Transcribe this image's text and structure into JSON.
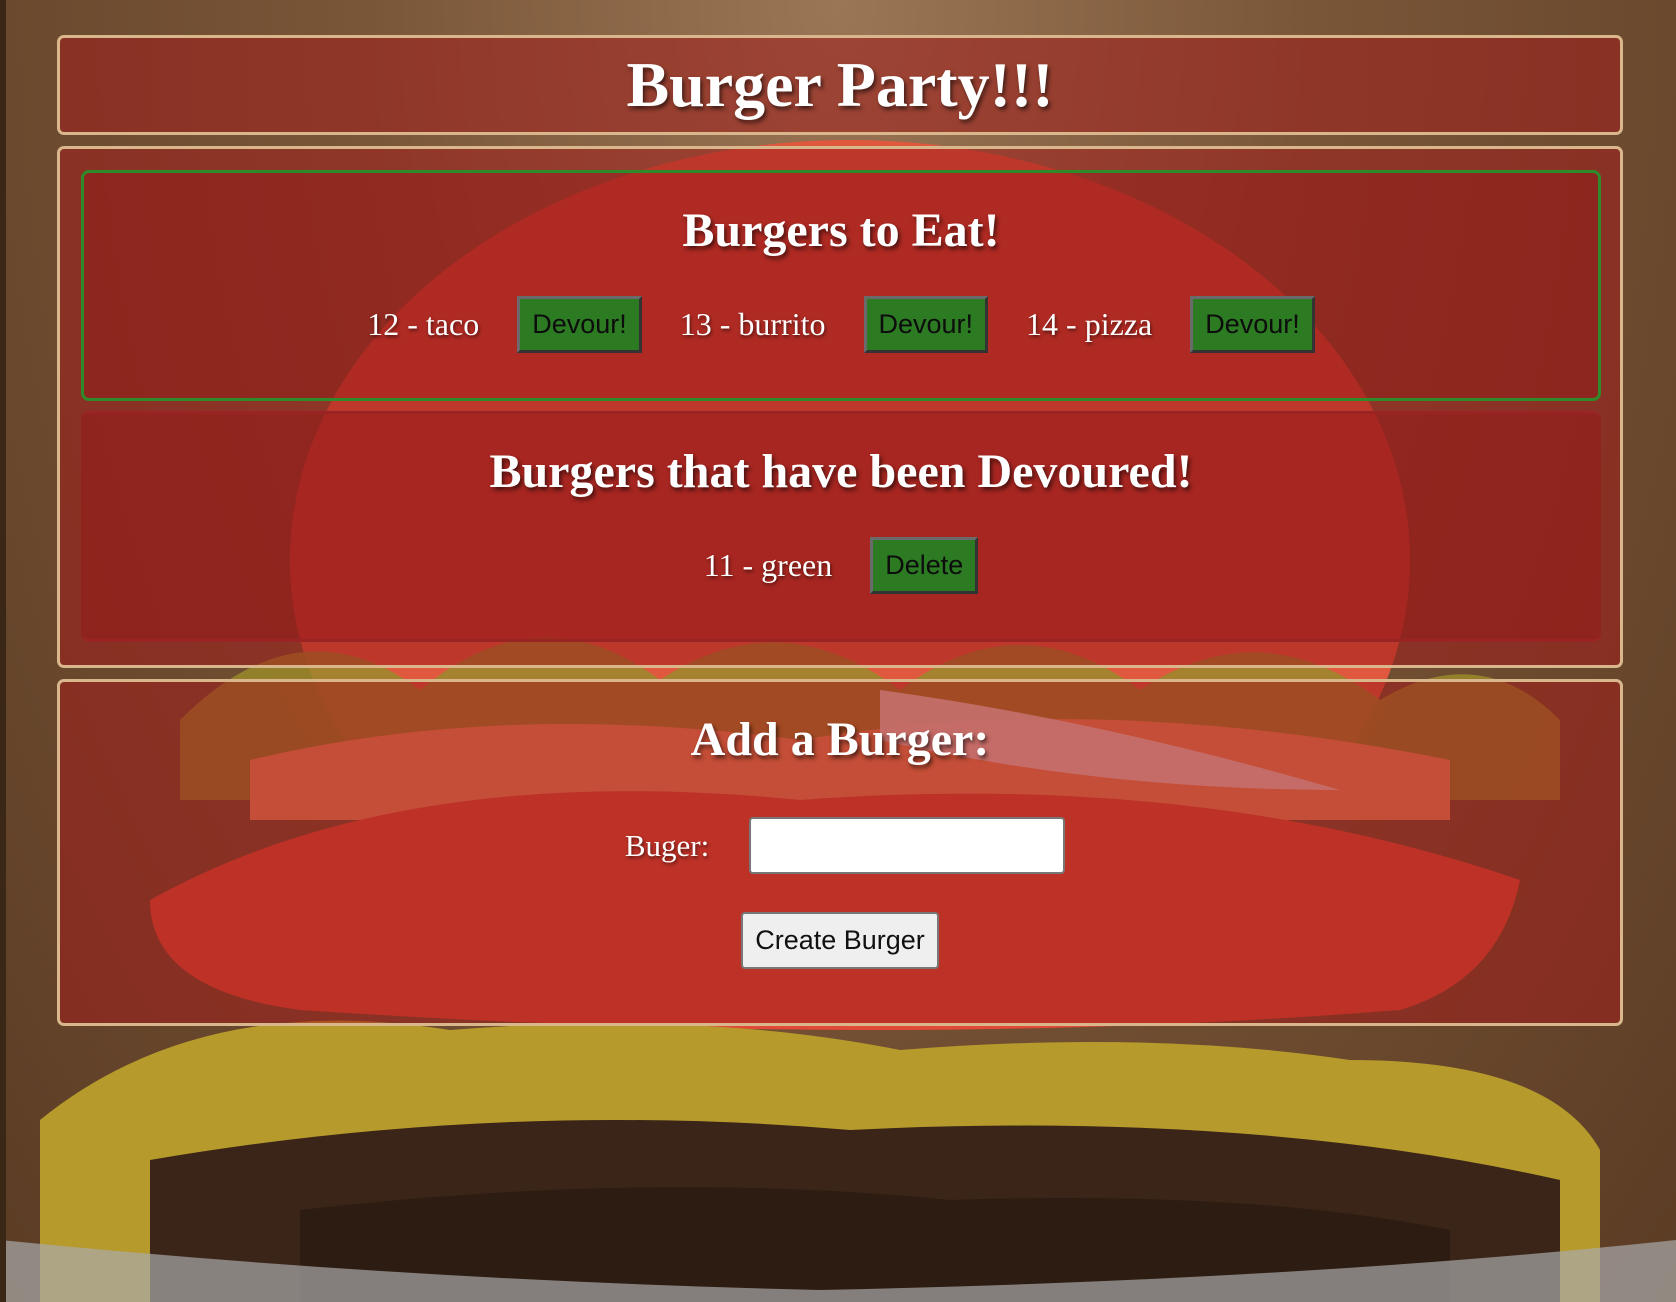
{
  "header": {
    "title": "Burger Party!!!"
  },
  "to_eat": {
    "heading": "Burgers to Eat!",
    "items": [
      {
        "label": "12 - taco",
        "button": "Devour!"
      },
      {
        "label": "13 - burrito",
        "button": "Devour!"
      },
      {
        "label": "14 - pizza",
        "button": "Devour!"
      }
    ]
  },
  "devoured": {
    "heading": "Burgers that have been Devoured!",
    "items": [
      {
        "label": "11 - green",
        "button": "Delete"
      }
    ]
  },
  "add": {
    "heading": "Add a Burger:",
    "input_label": "Buger:",
    "input_value": "",
    "submit_label": "Create Burger"
  },
  "colors": {
    "panel_border": "#d9b68c",
    "panel_bg": "#a01e1c",
    "to_eat_border": "#2f8a2a",
    "button_green": "#2c7a22"
  }
}
